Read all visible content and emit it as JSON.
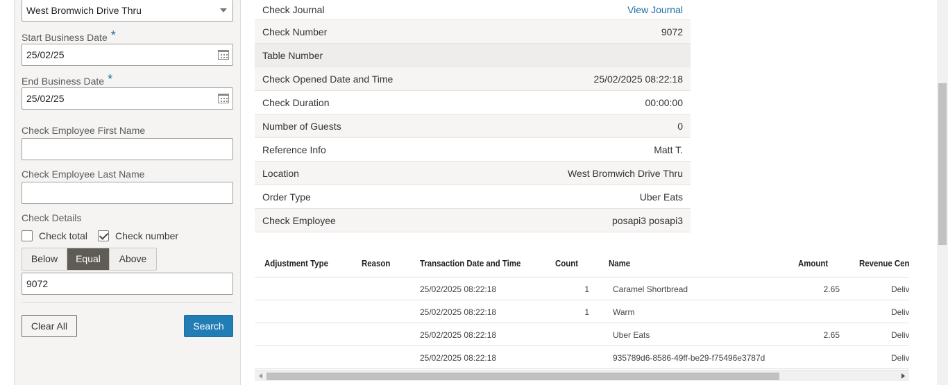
{
  "filters": {
    "location_value": "West Bromwich Drive Thru",
    "start_date_label": "Start Business Date",
    "start_date_value": "25/02/25",
    "end_date_label": "End Business Date",
    "end_date_value": "25/02/25",
    "required_mark": "*",
    "first_name_label": "Check Employee First Name",
    "first_name_value": "",
    "last_name_label": "Check Employee Last Name",
    "last_name_value": "",
    "check_details_label": "Check Details",
    "check_total_label": "Check total",
    "check_total_checked": false,
    "check_number_label": "Check number",
    "check_number_checked": true,
    "compare": [
      "Below",
      "Equal",
      "Above"
    ],
    "compare_selected": "Equal",
    "check_number_value": "9072",
    "clear_label": "Clear All",
    "search_label": "Search"
  },
  "details": [
    {
      "label": "Check Journal",
      "value": "View Journal",
      "is_link": true
    },
    {
      "label": "Check Number",
      "value": "9072"
    },
    {
      "label": "Table Number",
      "value": ""
    },
    {
      "label": "Check Opened Date and Time",
      "value": "25/02/2025 08:22:18"
    },
    {
      "label": "Check Duration",
      "value": "00:00:00"
    },
    {
      "label": "Number of Guests",
      "value": "0"
    },
    {
      "label": "Reference Info",
      "value": "Matt T."
    },
    {
      "label": "Location",
      "value": "West Bromwich Drive Thru"
    },
    {
      "label": "Order Type",
      "value": "Uber Eats"
    },
    {
      "label": "Check Employee",
      "value": "posapi3 posapi3"
    }
  ],
  "grid": {
    "columns": [
      "Adjustment Type",
      "Reason",
      "Transaction Date and Time",
      "Count",
      "Name",
      "Amount",
      "Revenue Cen"
    ],
    "rows": [
      {
        "adjustment": "",
        "reason": "",
        "datetime": "25/02/2025 08:22:18",
        "count": "1",
        "name": "Caramel Shortbread",
        "amount": "2.65",
        "revenue": "Deliv"
      },
      {
        "adjustment": "",
        "reason": "",
        "datetime": "25/02/2025 08:22:18",
        "count": "1",
        "name": "Warm",
        "amount": "",
        "revenue": "Deliv"
      },
      {
        "adjustment": "",
        "reason": "",
        "datetime": "25/02/2025 08:22:18",
        "count": "",
        "name": "Uber Eats",
        "amount": "2.65",
        "revenue": "Deliv"
      },
      {
        "adjustment": "",
        "reason": "",
        "datetime": "25/02/2025 08:22:18",
        "count": "",
        "name": "935789d6-8586-49ff-be29-f75496e3787d",
        "amount": "",
        "revenue": "Deliv"
      }
    ]
  },
  "colors": {
    "accent": "#227db5",
    "link": "#1b6ea8",
    "segment_active": "#5f5b55"
  }
}
